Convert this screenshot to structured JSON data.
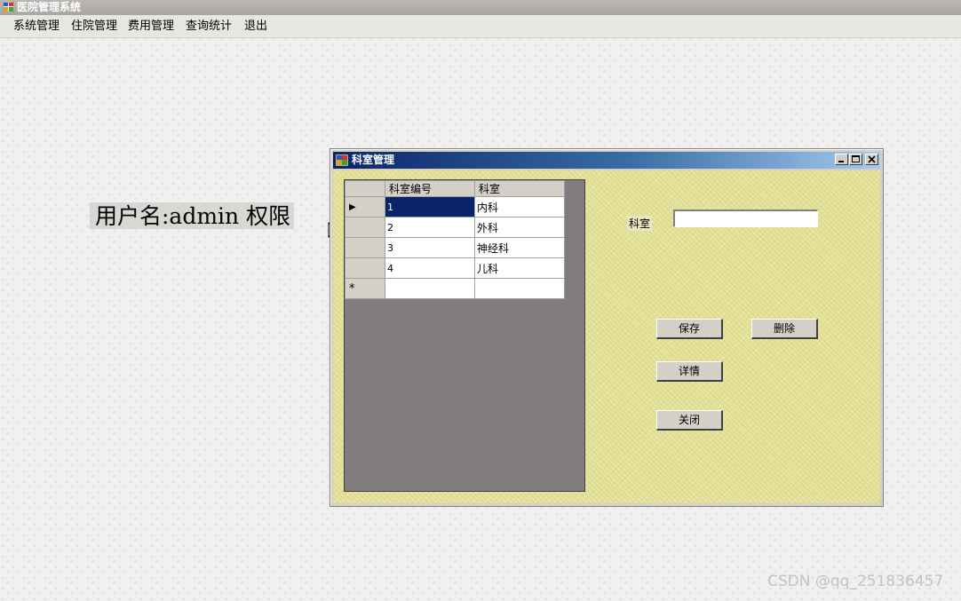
{
  "app": {
    "title": "医院管理系统"
  },
  "menubar": {
    "items": [
      "系统管理",
      "住院管理",
      "费用管理",
      "查询统计",
      "退出"
    ]
  },
  "user_label": "用户名:admin 权限",
  "dialog": {
    "title": "科室管理",
    "grid": {
      "columns": [
        "科室编号",
        "科室"
      ],
      "rows": [
        {
          "id": "1",
          "name": "内科"
        },
        {
          "id": "2",
          "name": "外科"
        },
        {
          "id": "3",
          "name": "神经科"
        },
        {
          "id": "4",
          "name": "儿科"
        }
      ],
      "current_row_marker": "▶",
      "new_row_marker": "*"
    },
    "field_label": "科室",
    "field_value": "",
    "buttons": {
      "save": "保存",
      "delete": "删除",
      "details": "详情",
      "close": "关闭"
    }
  },
  "watermark": "CSDN @qq_251836457"
}
